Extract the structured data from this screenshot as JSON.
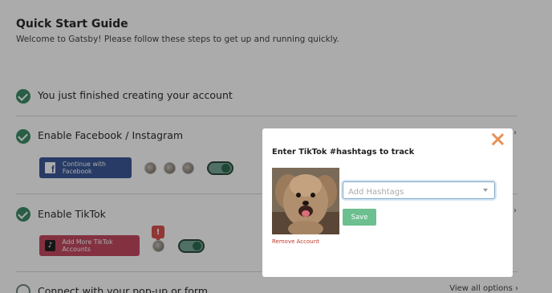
{
  "guide": {
    "title": "Quick Start Guide",
    "subtitle": "Welcome to Gatsby! Please follow these steps to get up and running quickly."
  },
  "steps": [
    {
      "label": "You just finished creating your account",
      "completed": true
    },
    {
      "label": "Enable Facebook / Instagram",
      "completed": true
    },
    {
      "label": "Enable TikTok",
      "completed": true
    },
    {
      "label": "Connect with your pop-up or form",
      "completed": false
    }
  ],
  "facebook": {
    "button_label": "Continue with Facebook",
    "toggle_on": true
  },
  "tiktok": {
    "button_label": "Add More TikTok Accounts",
    "alert_text": "!",
    "toggle_on": true
  },
  "footer": {
    "view_all": "View all options ›"
  },
  "modal": {
    "title": "Enter TikTok #hashtags to track",
    "input_placeholder": "Add Hashtags",
    "save_label": "Save",
    "remove_label": "Remove Account"
  },
  "colors": {
    "accent_green": "#3d8c68",
    "facebook_blue": "#3b5998",
    "tiktok_pink": "#c44a62",
    "save_green": "#6cbf8e",
    "close_orange": "#e8915a",
    "remove_red": "#c0392b"
  }
}
